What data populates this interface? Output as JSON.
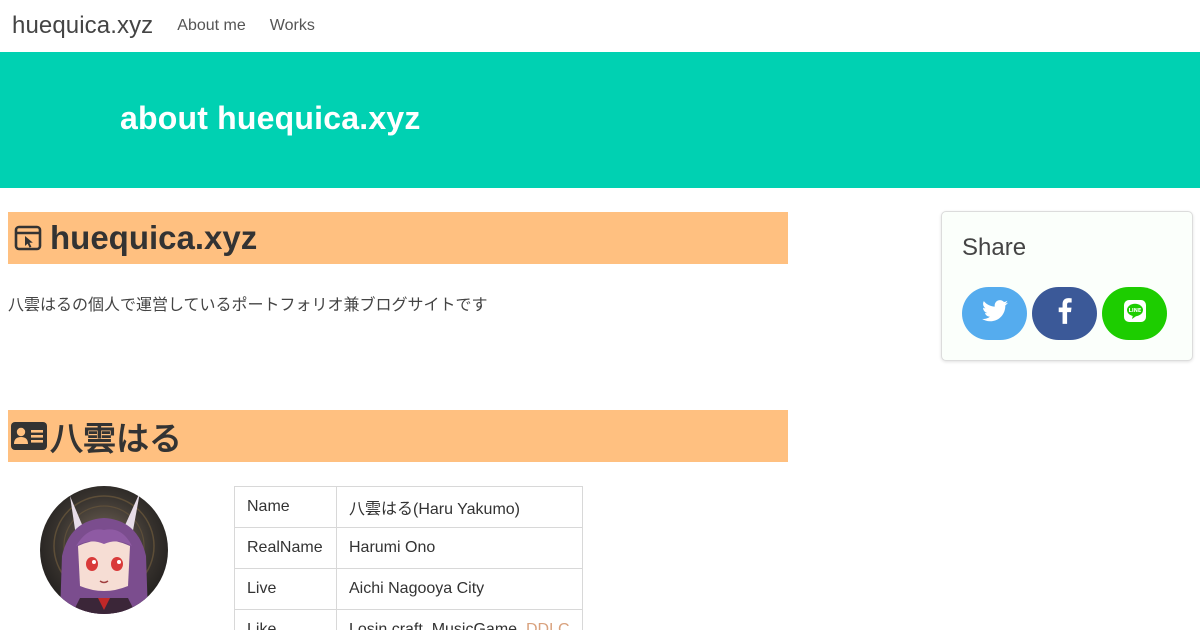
{
  "navbar": {
    "brand": "huequica.xyz",
    "links": [
      "About me",
      "Works"
    ]
  },
  "hero": {
    "title": "about huequica.xyz",
    "background": "#00d1b2"
  },
  "site_section": {
    "icon": "browser-window-icon",
    "heading": "huequica.xyz",
    "description": "八雲はるの個人で運営しているポートフォリオ兼ブログサイトです"
  },
  "profile_section": {
    "icon": "id-card-icon",
    "heading": "八雲はる",
    "avatar": "avatar-image",
    "rows": [
      {
        "key": "Name",
        "value": "八雲はる(Haru Yakumo)"
      },
      {
        "key": "RealName",
        "value": "Harumi Ono"
      },
      {
        "key": "Live",
        "value": "Aichi Nagooya City"
      },
      {
        "key": "Like",
        "value": "Losin craft, MusicGame,",
        "link": "DDLC"
      }
    ]
  },
  "share": {
    "title": "Share",
    "buttons": [
      {
        "name": "twitter",
        "icon": "twitter-icon",
        "color": "#55acee"
      },
      {
        "name": "facebook",
        "icon": "facebook-icon",
        "color": "#3b5998"
      },
      {
        "name": "line",
        "icon": "line-icon",
        "color": "#1dcd00"
      }
    ]
  },
  "colors": {
    "heading_background": "#ffc080",
    "link": "#d9a27e"
  }
}
